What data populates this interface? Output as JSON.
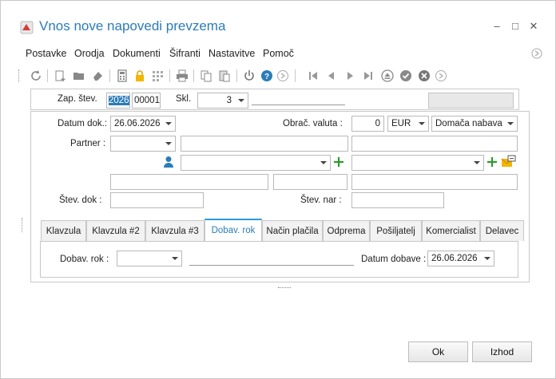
{
  "window": {
    "title": "Vnos nove napovedi prevzema"
  },
  "menu": [
    "Postavke",
    "Orodja",
    "Dokumenti",
    "Šifranti",
    "Nastavitve",
    "Pomoč"
  ],
  "header": {
    "zap_label": "Zap. štev.",
    "zap_year": "2026",
    "zap_number": "00001",
    "skl_label": "Skl.",
    "skl_value": "3"
  },
  "form": {
    "datum_label": "Datum dok.:",
    "datum_value": "26.06.2026",
    "obrac_label": "Obrač. valuta :",
    "obrac_value": "0",
    "currency": "EUR",
    "nabava": "Domača nabava",
    "partner_label": "Partner :",
    "stev_dok_label": "Štev. dok :",
    "stev_nar_label": "Štev. nar :"
  },
  "tabs": [
    "Klavzula",
    "Klavzula #2",
    "Klavzula #3",
    "Dobav. rok",
    "Način plačila",
    "Odprema",
    "Pošiljatelj",
    "Komercialist",
    "Delavec"
  ],
  "tab_content": {
    "dobav_rok_label": "Dobav. rok :",
    "datum_dobave_label": "Datum dobave :",
    "datum_dobave_value": "26.06.2026"
  },
  "buttons": {
    "ok": "Ok",
    "cancel": "Izhod"
  },
  "colors": {
    "accent": "#2b7cb8",
    "tab_highlight": "#2b9bd7"
  }
}
